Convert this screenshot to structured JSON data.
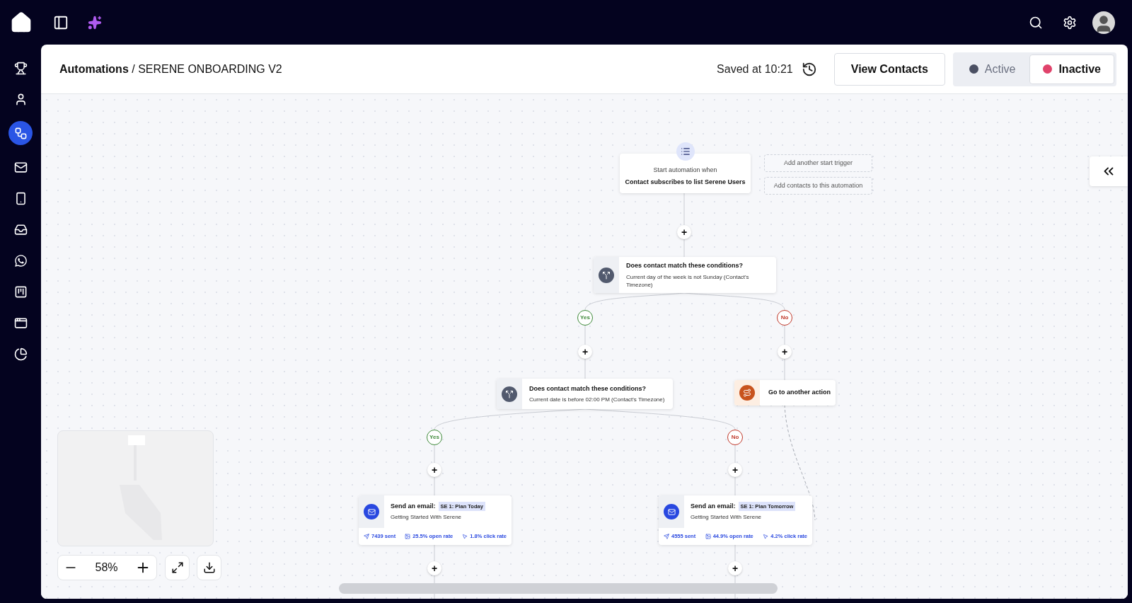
{
  "sidebar": {
    "items": [
      {
        "selected": false
      },
      {
        "selected": false
      },
      {
        "selected": true
      },
      {
        "selected": false
      },
      {
        "selected": false
      },
      {
        "selected": false
      },
      {
        "selected": false
      },
      {
        "selected": false
      },
      {
        "selected": false
      },
      {
        "selected": false
      }
    ]
  },
  "header": {
    "breadcrumb_parent": "Automations",
    "separator": "/",
    "breadcrumb_current": "SERENE ONBOARDING V2",
    "saved": "Saved at 10:21",
    "view_contacts": "View Contacts",
    "status_options": [
      {
        "label": "Active",
        "color": "#4b5063",
        "selected": false
      },
      {
        "label": "Inactive",
        "color": "#e0436b",
        "selected": true
      }
    ]
  },
  "canvas": {
    "nodes": [
      {
        "kind": "trigger",
        "caption": "Start automation when",
        "title": "Contact subscribes to list Serene Users"
      },
      {
        "kind": "dashed",
        "label": "Add another start trigger"
      },
      {
        "kind": "dashed",
        "label": "Add contacts to this automation"
      },
      {
        "kind": "add",
        "label": "+"
      },
      {
        "kind": "condition",
        "title": "Does contact match these conditions?",
        "detail": "Current day of the week is not Sunday (Contact's Timezone)"
      },
      {
        "kind": "branch",
        "label": "Yes",
        "color": "#3f8a3a"
      },
      {
        "kind": "branch",
        "label": "No",
        "color": "#c0392b"
      },
      {
        "kind": "add",
        "label": "+"
      },
      {
        "kind": "add",
        "label": "+"
      },
      {
        "kind": "condition",
        "title": "Does contact match these conditions?",
        "detail": "Current date is before 02:00 PM (Contact's Timezone)"
      },
      {
        "kind": "goto",
        "title": "Go to another action"
      },
      {
        "kind": "branch",
        "label": "Yes",
        "color": "#3f8a3a"
      },
      {
        "kind": "branch",
        "label": "No",
        "color": "#c0392b"
      },
      {
        "kind": "add",
        "label": "+"
      },
      {
        "kind": "add",
        "label": "+"
      },
      {
        "kind": "email",
        "title": "Send an email:",
        "tag": "SE 1: Plan Today",
        "subject": "Getting Started With Serene",
        "sent": "7439 sent",
        "open": "25.5% open rate",
        "click": "1.8% click rate"
      },
      {
        "kind": "email",
        "title": "Send an email:",
        "tag": "SE 1: Plan Tomorrow",
        "subject": "Getting Started With Serene",
        "sent": "4555 sent",
        "open": "44.9% open rate",
        "click": "4.2% click rate"
      },
      {
        "kind": "add",
        "label": "+"
      },
      {
        "kind": "add",
        "label": "+"
      }
    ],
    "zoom": "58%"
  }
}
